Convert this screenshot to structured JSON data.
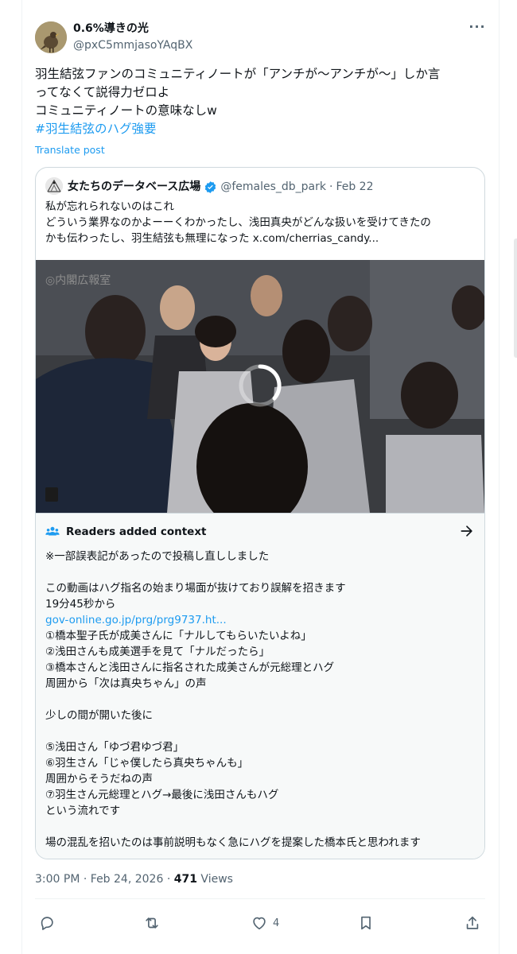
{
  "author": {
    "display_name": "0.6%導きの光",
    "handle": "@pxC5mmjasoYAqBX"
  },
  "tweet": {
    "lines": [
      "羽生結弦ファンのコミュニティノートが「アンチが〜アンチが〜」しか言",
      "ってなくて説得力ゼロよ",
      "コミュニティノートの意味なしw"
    ],
    "hashtag": "#羽生結弦のハグ強要",
    "translate_label": "Translate post"
  },
  "quote": {
    "name": "女たちのデータベース広場",
    "handle": "@females_db_park",
    "date": "Feb 22",
    "lines": [
      "私が忘れられないのはこれ",
      "どういう業界なのかよーーくわかったし、浅田真央がどんな扱いを受けてきたの",
      "かも伝わったし、羽生結弦も無理になった  x.com/cherrias_candy..."
    ],
    "video_watermark": "◎内閣広報室"
  },
  "context": {
    "title": "Readers added context",
    "lines": [
      "※一部誤表記があったので投稿し直ししました",
      "",
      "この動画はハグ指名の始まり場面が抜けており誤解を招きます",
      "19分45秒から"
    ],
    "link": "gov-online.go.jp/prg/prg9737.ht...",
    "lines_after_link": [
      "①橋本聖子氏が成美さんに「ナルしてもらいたいよね」",
      "②浅田さんも成美選手を見て「ナルだったら」",
      "③橋本さんと浅田さんに指名された成美さんが元総理とハグ",
      "周囲から「次は真央ちゃん」の声",
      "",
      "少しの間が開いた後に",
      "",
      "⑤浅田さん「ゆづ君ゆづ君」",
      "⑥羽生さん「じゃ僕したら真央ちゃんも」",
      "周囲からそうだねの声",
      "⑦羽生さん元総理とハグ→最後に浅田さんもハグ",
      "という流れです",
      "",
      "場の混乱を招いたのは事前説明もなく急にハグを提案した橋本氏と思われます"
    ]
  },
  "meta": {
    "time": "3:00 PM",
    "date": "Feb 24, 2026",
    "separator": "·",
    "views_count": "471",
    "views_label": "Views"
  },
  "actions": {
    "likes_count": "4"
  },
  "colors": {
    "link_blue": "#1d9bf0",
    "muted_gray": "#536471",
    "border": "#cfd9de",
    "context_bg": "#f7f9f9"
  }
}
